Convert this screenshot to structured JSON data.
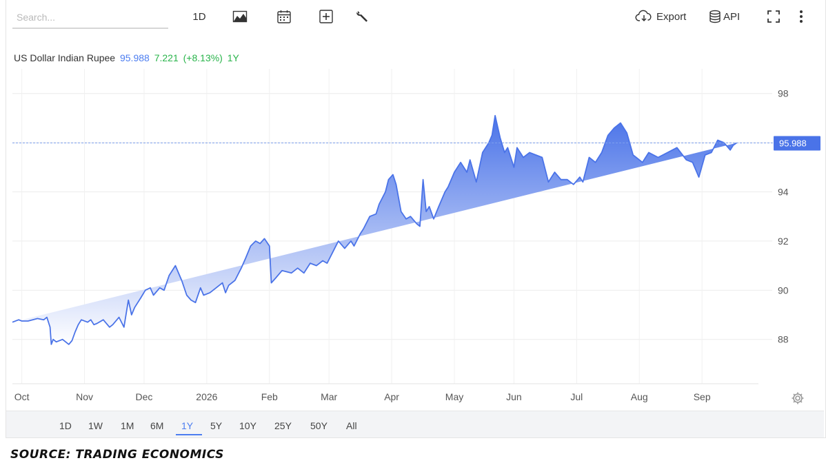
{
  "toolbar": {
    "search_placeholder": "Search...",
    "interval_label": "1D",
    "export_label": "Export",
    "api_label": "API",
    "icons": [
      "area-chart-icon",
      "calendar-icon",
      "compare-icon",
      "wrench-icon",
      "cloud-download-icon",
      "database-icon",
      "fullscreen-icon",
      "more-vertical-icon"
    ]
  },
  "series_header": {
    "name": "US Dollar Indian Rupee",
    "last": "95.988",
    "change": "7.221",
    "change_pct": "(+8.13%)",
    "period": "1Y"
  },
  "range_buttons": [
    "1D",
    "1W",
    "1M",
    "6M",
    "1Y",
    "5Y",
    "10Y",
    "25Y",
    "50Y",
    "All"
  ],
  "range_active": "1Y",
  "source": "Source: Trading Economics",
  "colors": {
    "line": "#4a73e8",
    "fill_top": "#4a73e8",
    "fill_bottom": "#ffffff",
    "last_price_bg": "#4a73e8",
    "accent_blue": "#4c7df0",
    "accent_green": "#28b44a"
  },
  "chart_data": {
    "type": "area",
    "title": "US Dollar Indian Rupee",
    "xlabel": "",
    "ylabel": "",
    "ylim": [
      86.2,
      99
    ],
    "y_ticks": [
      88,
      90,
      92,
      94,
      96,
      98
    ],
    "y_tick_labels": [
      "88",
      "90",
      "92",
      "94",
      "",
      "98"
    ],
    "x_ticks": [
      "Oct",
      "Nov",
      "Dec",
      "2026",
      "Feb",
      "Mar",
      "Apr",
      "May",
      "Jun",
      "Jul",
      "Aug",
      "Sep"
    ],
    "x_tick_pos": [
      0.15,
      1.15,
      2.1,
      3.1,
      4.1,
      5.05,
      6.05,
      7.05,
      8.0,
      9.0,
      10.0,
      11.0
    ],
    "xlim": [
      0,
      11.9
    ],
    "last_value_label": "95.988",
    "grid": true,
    "x": [
      0,
      0.1,
      0.15,
      0.25,
      0.4,
      0.5,
      0.55,
      0.6,
      0.62,
      0.65,
      0.7,
      0.8,
      0.9,
      0.95,
      1.0,
      1.05,
      1.1,
      1.2,
      1.25,
      1.3,
      1.35,
      1.45,
      1.55,
      1.6,
      1.7,
      1.78,
      1.85,
      1.9,
      1.95,
      2.05,
      2.12,
      2.2,
      2.25,
      2.35,
      2.42,
      2.5,
      2.6,
      2.7,
      2.78,
      2.85,
      2.92,
      3.0,
      3.05,
      3.15,
      3.25,
      3.35,
      3.4,
      3.45,
      3.55,
      3.65,
      3.72,
      3.8,
      3.88,
      3.95,
      4.02,
      4.1,
      4.13,
      4.2,
      4.3,
      4.45,
      4.55,
      4.65,
      4.75,
      4.85,
      4.95,
      5.02,
      5.1,
      5.2,
      5.3,
      5.4,
      5.45,
      5.55,
      5.6,
      5.7,
      5.8,
      5.85,
      5.95,
      6.0,
      6.07,
      6.12,
      6.2,
      6.28,
      6.35,
      6.45,
      6.5,
      6.55,
      6.6,
      6.65,
      6.72,
      6.8,
      6.9,
      6.95,
      7.05,
      7.15,
      7.25,
      7.3,
      7.4,
      7.5,
      7.6,
      7.65,
      7.7,
      7.78,
      7.85,
      7.9,
      8.0,
      8.05,
      8.15,
      8.25,
      8.35,
      8.45,
      8.55,
      8.65,
      8.75,
      8.85,
      8.95,
      9.05,
      9.1,
      9.2,
      9.3,
      9.4,
      9.5,
      9.6,
      9.7,
      9.8,
      9.9,
      9.95,
      10.05,
      10.15,
      10.3,
      10.45,
      10.6,
      10.75,
      10.85,
      10.95,
      11.05,
      11.15,
      11.25,
      11.35,
      11.45,
      11.5,
      11.55,
      11.6,
      11.7,
      11.75,
      11.8,
      11.85,
      11.9
    ],
    "series": [
      {
        "values": [
          88.7,
          88.8,
          88.75,
          88.75,
          88.85,
          88.8,
          88.9,
          88.5,
          87.8,
          88.0,
          87.9,
          88.0,
          87.8,
          87.95,
          88.3,
          88.6,
          88.8,
          88.7,
          88.8,
          88.6,
          88.65,
          88.8,
          88.5,
          88.6,
          88.9,
          88.5,
          89.6,
          89.0,
          89.3,
          89.7,
          90.0,
          90.1,
          89.8,
          90.1,
          90.0,
          90.6,
          91.0,
          90.4,
          89.8,
          89.6,
          89.5,
          90.1,
          89.8,
          89.9,
          90.1,
          90.3,
          89.9,
          90.2,
          90.4,
          90.9,
          91.3,
          91.8,
          92.0,
          91.9,
          92.1,
          91.8,
          90.3,
          90.5,
          90.8,
          90.7,
          90.9,
          90.7,
          91.1,
          91.0,
          91.2,
          91.1,
          91.5,
          92.0,
          91.7,
          92.0,
          91.8,
          92.3,
          92.5,
          93.0,
          93.1,
          93.5,
          94.0,
          94.5,
          94.7,
          94.3,
          93.2,
          92.9,
          93.0,
          92.7,
          92.6,
          94.5,
          93.2,
          93.4,
          92.9,
          93.4,
          94.0,
          94.2,
          94.8,
          95.2,
          94.8,
          95.3,
          94.4,
          95.6,
          96.0,
          96.3,
          97.1,
          96.2,
          95.6,
          95.8,
          95.0,
          95.8,
          95.4,
          95.6,
          95.5,
          95.4,
          94.4,
          94.8,
          94.5,
          94.5,
          94.3,
          94.6,
          94.4,
          95.4,
          95.2,
          95.6,
          96.3,
          96.6,
          96.8,
          96.4,
          95.5,
          95.4,
          95.2,
          95.6,
          95.4,
          95.6,
          95.8,
          95.3,
          95.2,
          94.6,
          95.5,
          95.6,
          96.1,
          96.0,
          95.7,
          95.9,
          95.988
        ]
      }
    ]
  }
}
